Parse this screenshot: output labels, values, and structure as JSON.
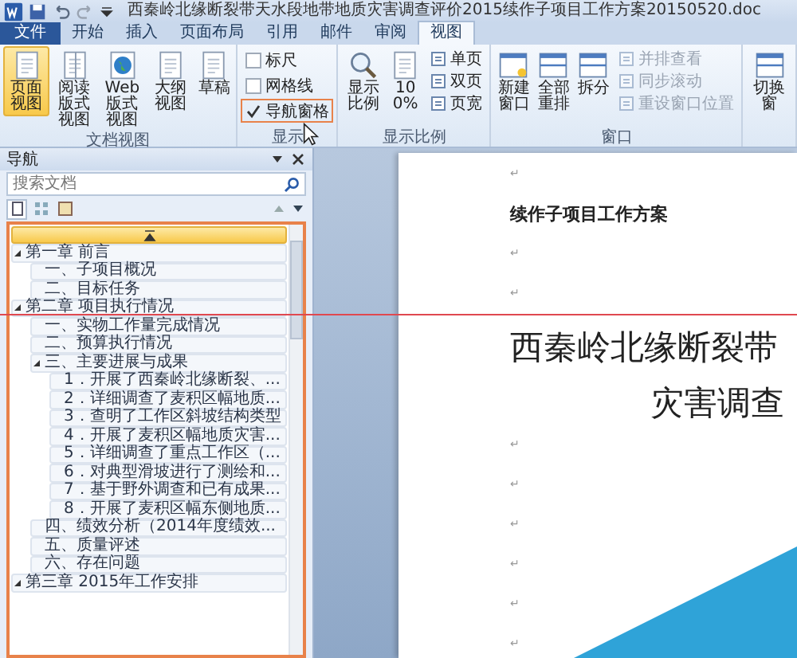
{
  "window": {
    "title": "西秦岭北缘断裂带天水段地带地质灾害调查评价2015续作子项目工作方案20150520.doc"
  },
  "tabs": [
    {
      "label": "文件",
      "kind": "file",
      "selected": false
    },
    {
      "label": "开始",
      "kind": "tab",
      "selected": false
    },
    {
      "label": "插入",
      "kind": "tab",
      "selected": false
    },
    {
      "label": "页面布局",
      "kind": "tab",
      "selected": false
    },
    {
      "label": "引用",
      "kind": "tab",
      "selected": false
    },
    {
      "label": "邮件",
      "kind": "tab",
      "selected": false
    },
    {
      "label": "审阅",
      "kind": "tab",
      "selected": false
    },
    {
      "label": "视图",
      "kind": "tab",
      "selected": true
    }
  ],
  "ribbon": {
    "groups": [
      {
        "label": "文档视图",
        "items": [
          {
            "kind": "large",
            "label": "页面视图",
            "selected": true
          },
          {
            "kind": "large",
            "label": "阅读版式视图",
            "selected": false
          },
          {
            "kind": "large",
            "label": "Web 版式视图",
            "selected": false
          },
          {
            "kind": "large",
            "label": "大纲视图",
            "selected": false
          },
          {
            "kind": "large",
            "label": "草稿",
            "selected": false
          }
        ]
      },
      {
        "label": "显示",
        "items": [
          {
            "kind": "check",
            "label": "标尺",
            "checked": false,
            "highlighted": false
          },
          {
            "kind": "check",
            "label": "网格线",
            "checked": false,
            "highlighted": false
          },
          {
            "kind": "check",
            "label": "导航窗格",
            "checked": true,
            "highlighted": true
          }
        ]
      },
      {
        "label": "显示比例",
        "items": [
          {
            "kind": "large",
            "label": "显示比例"
          },
          {
            "kind": "large",
            "label": "100%"
          },
          {
            "kind": "small",
            "label": "单页",
            "disabled": false
          },
          {
            "kind": "small",
            "label": "双页",
            "disabled": false
          },
          {
            "kind": "small",
            "label": "页宽",
            "disabled": false
          }
        ]
      },
      {
        "label": "窗口",
        "items": [
          {
            "kind": "large",
            "label": "新建窗口"
          },
          {
            "kind": "large",
            "label": "全部重排"
          },
          {
            "kind": "large",
            "label": "拆分"
          },
          {
            "kind": "small",
            "label": "并排查看",
            "disabled": true
          },
          {
            "kind": "small",
            "label": "同步滚动",
            "disabled": true
          },
          {
            "kind": "small",
            "label": "重设窗口位置",
            "disabled": true
          }
        ]
      },
      {
        "items": [
          {
            "kind": "large",
            "label": "切换窗"
          }
        ]
      }
    ]
  },
  "navigation": {
    "title": "导航",
    "search": {
      "placeholder": "搜索文档"
    },
    "view_tabs": [
      {
        "selected": true
      },
      {
        "selected": false
      },
      {
        "selected": false
      }
    ],
    "tree": {
      "highlighted": true,
      "headings": [
        {
          "text": "第一章 前言",
          "expanded": true,
          "children": [
            {
              "text": "一、子项目概况"
            },
            {
              "text": "二、目标任务"
            }
          ]
        },
        {
          "text": "第二章 项目执行情况",
          "expanded": true,
          "children": [
            {
              "text": "一、实物工作量完成情况"
            },
            {
              "text": "二、预算执行情况"
            },
            {
              "text": "三、主要进展与成果",
              "expanded": true,
              "children": [
                {
                  "text": "1．开展了西秦岭北缘断裂、..."
                },
                {
                  "text": "2．详细调查了麦积区幅地质..."
                },
                {
                  "text": "3．查明了工作区斜坡结构类型"
                },
                {
                  "text": "4．开展了麦积区幅地质灾害..."
                },
                {
                  "text": "5．详细调查了重点工作区（..."
                },
                {
                  "text": "6．对典型滑坡进行了测绘和..."
                },
                {
                  "text": "7．基于野外调查和已有成果..."
                },
                {
                  "text": "8．开展了麦积区幅东侧地质..."
                }
              ]
            },
            {
              "text": "四、绩效分析（2014年度绩效..."
            },
            {
              "text": "五、质量评述"
            },
            {
              "text": "六、存在问题"
            }
          ]
        },
        {
          "text": "第三章 2015年工作安排",
          "expanded": true
        }
      ]
    }
  },
  "document": {
    "paragraphs": [
      {
        "kind": "mark",
        "text": "↵"
      },
      {
        "kind": "heading",
        "text": "续作子项目工作方案"
      },
      {
        "kind": "mark",
        "text": "↵"
      },
      {
        "kind": "mark",
        "text": "↵"
      },
      {
        "kind": "title",
        "text": "西秦岭北缘断裂带"
      },
      {
        "kind": "title2",
        "text": "灾害调查"
      },
      {
        "kind": "mark",
        "text": "↵"
      },
      {
        "kind": "mark",
        "text": "↵"
      },
      {
        "kind": "mark",
        "text": "↵"
      },
      {
        "kind": "mark",
        "text": "↵"
      },
      {
        "kind": "mark",
        "text": "↵"
      },
      {
        "kind": "mark",
        "text": "↵"
      }
    ]
  }
}
